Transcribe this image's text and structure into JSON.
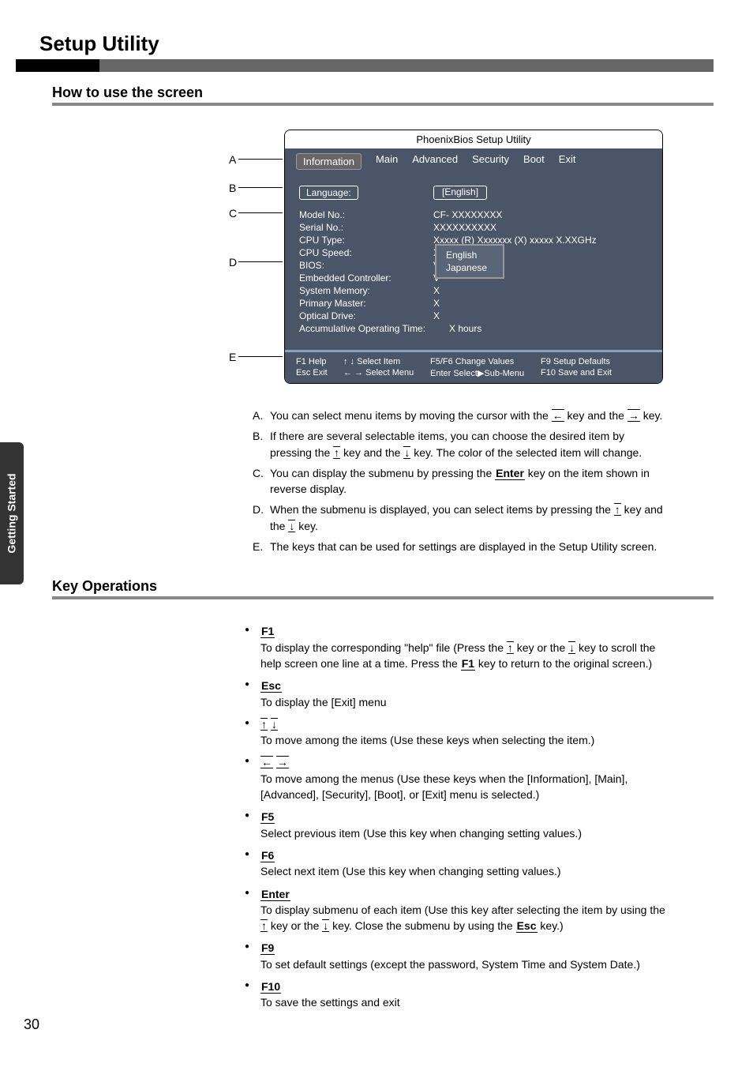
{
  "pageNumber": "30",
  "sideTab": "Getting Started",
  "h1": "Setup Utility",
  "h2a": "How to use the screen",
  "h2b": "Key Operations",
  "labels": {
    "A": "A",
    "B": "B",
    "C": "C",
    "D": "D",
    "E": "E"
  },
  "bios": {
    "title": "PhoenixBios Setup Utility",
    "tabs": [
      "Information",
      "Main",
      "Advanced",
      "Security",
      "Boot",
      "Exit"
    ],
    "lang_label": "Language:",
    "lang_value": "[English]",
    "rows": [
      {
        "k": "Model No.:",
        "v": "CF- XXXXXXXX"
      },
      {
        "k": "Serial No.:",
        "v": "XXXXXXXXXX"
      },
      {
        "k": "CPU Type:",
        "v": "Xxxxx (R) Xxxxxxx (X) xxxxx X.XXGHz"
      },
      {
        "k": "CPU Speed:",
        "v": "X.XX GHz"
      },
      {
        "k": "BIOS:",
        "v": "V"
      },
      {
        "k": "Embedded Controller:",
        "v": "V"
      },
      {
        "k": "System Memory:",
        "v": "X"
      },
      {
        "k": "Primary Master:",
        "v": "X"
      },
      {
        "k": "Optical Drive:",
        "v": "X"
      },
      {
        "k": "Accumulative Operating Time:",
        "v": "X hours"
      }
    ],
    "submenu": [
      "English",
      "Japanese"
    ],
    "foot": {
      "r1c1": "F1  Help",
      "r1c2": "↑ ↓ Select Item",
      "r1c3": "F5/F6 Change Values",
      "r1c4": "F9  Setup Defaults",
      "r2c1": "Esc Exit",
      "r2c2": "← → Select Menu",
      "r2c3": "Enter  Select▶Sub-Menu",
      "r2c4": "F10 Save and Exit"
    }
  },
  "descA_1": "You can select menu items by moving the cursor with the ",
  "descA_2": " key and the ",
  "descA_3": " key.",
  "descB_1": "If there are several selectable items, you can choose the desired item by pressing the ",
  "descB_2": " key and the ",
  "descB_3": " key.  The color of the selected item will change.",
  "descC_1": "You can display the submenu by pressing the ",
  "descC_2": " key on the item shown in reverse display.",
  "descD_1": "When the submenu is displayed, you can select items by pressing the ",
  "descD_2": " key and the ",
  "descD_3": " key.",
  "descE": "The keys that can be used for settings are displayed in the Setup Utility screen.",
  "keys": {
    "left": "←",
    "right": "→",
    "up": "↑",
    "down": "↓",
    "F1": "F1",
    "Esc": "Esc",
    "F5": "F5",
    "F6": "F6",
    "Enter": "Enter",
    "F9": "F9",
    "F10": "F10"
  },
  "ops": {
    "f1_1": "To display the corresponding \"help\" file (Press the ",
    "f1_2": " key or the ",
    "f1_3": " key to scroll the help screen one line at a time. Press the ",
    "f1_4": " key to return to the original screen.)",
    "esc": "To display the [Exit] menu",
    "ud": "To move among the items (Use these keys when selecting the item.)",
    "lr": "To move among the menus (Use these keys when the [Information], [Main], [Advanced], [Security], [Boot], or [Exit] menu is selected.)",
    "f5": "Select previous item (Use this key when changing setting values.)",
    "f6": "Select next item (Use this key when changing setting values.)",
    "enter_1": "To display submenu of each item (Use this key after selecting the item by using the ",
    "enter_2": " key or the ",
    "enter_3": " key. Close the submenu by using the ",
    "enter_4": " key.)",
    "f9": "To set default settings (except the password, System Time and System Date.)",
    "f10": "To save the settings and exit"
  }
}
